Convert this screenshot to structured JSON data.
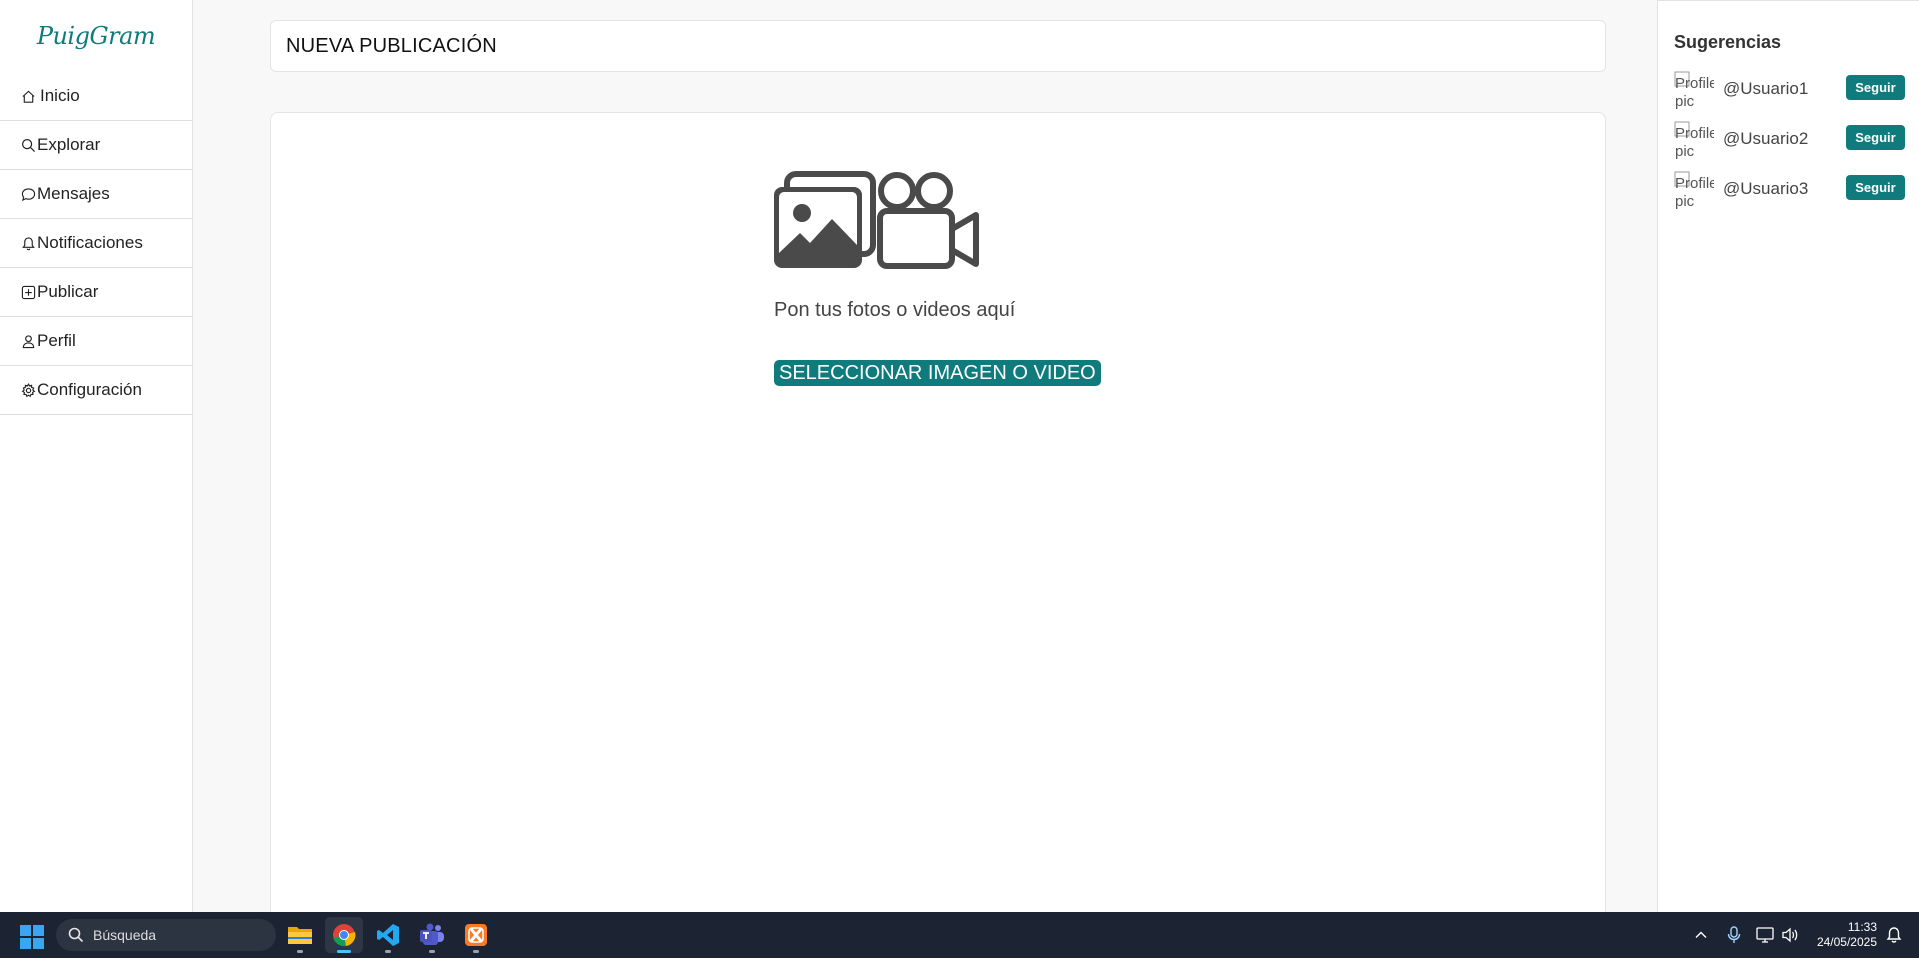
{
  "app": {
    "logo": "PuigGram",
    "accent_color": "#0f7b7c"
  },
  "sidebar": {
    "items": [
      {
        "label": "Inicio",
        "icon": "home-icon"
      },
      {
        "label": "Explorar",
        "icon": "search-icon"
      },
      {
        "label": "Mensajes",
        "icon": "chat-bubble-icon"
      },
      {
        "label": "Notificaciones",
        "icon": "bell-icon"
      },
      {
        "label": "Publicar",
        "icon": "plus-square-icon"
      },
      {
        "label": "Perfil",
        "icon": "person-icon"
      },
      {
        "label": "Configuración",
        "icon": "gear-icon"
      }
    ]
  },
  "main": {
    "title": "NUEVA PUBLICACIÓN",
    "upload_icon": "image-and-video-icon",
    "upload_text": "Pon tus fotos o videos aquí",
    "select_button": "SELECCIONAR IMAGEN O VIDEO"
  },
  "suggestions": {
    "title": "Sugerencias",
    "follow_label": "Seguir",
    "avatar_alt": "Profile pic",
    "users": [
      {
        "name": "@Usuario1"
      },
      {
        "name": "@Usuario2"
      },
      {
        "name": "@Usuario3"
      }
    ]
  },
  "taskbar": {
    "search_placeholder": "Búsqueda",
    "apps": [
      "file-explorer-icon",
      "chrome-icon",
      "vscode-icon",
      "teams-icon",
      "xampp-icon"
    ],
    "time": "11:33",
    "date": "24/05/2025"
  }
}
